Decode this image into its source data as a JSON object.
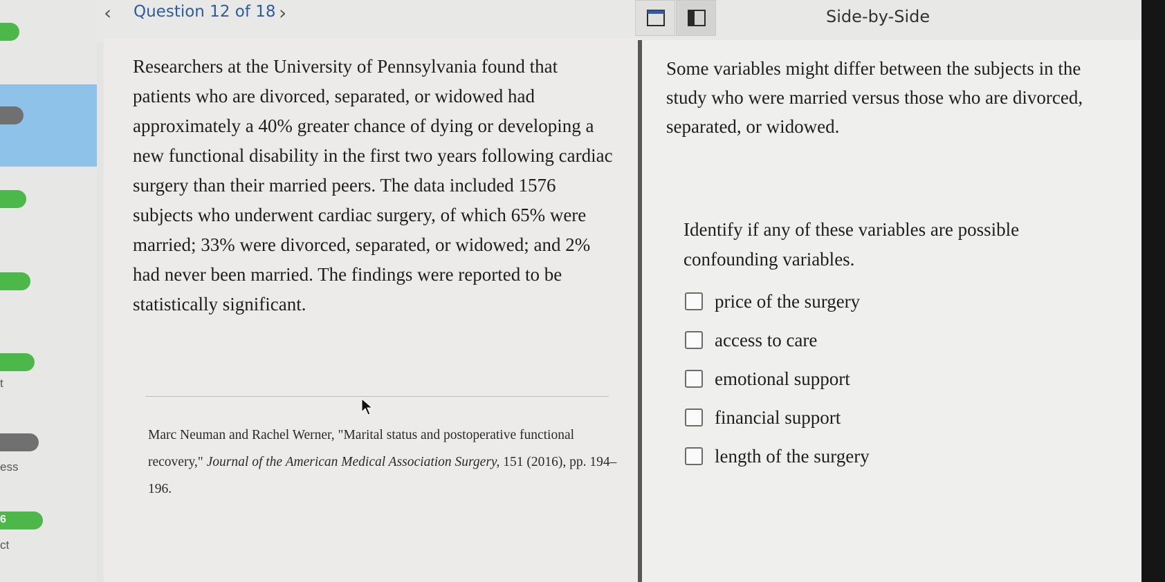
{
  "sidebar": {
    "labels": [
      "ess",
      "ct"
    ],
    "pct_label": "6",
    "edge_mark": "t"
  },
  "header": {
    "prev_icon": "chevron-left-icon",
    "next_icon": "chevron-right-icon",
    "question_counter": "Question 12 of 18",
    "layout_label": "Side-by-Side",
    "accent_color": "#2e5c9e"
  },
  "passage": {
    "text": "Researchers at the University of Pennsylvania found that patients who are divorced, separated, or widowed had approximately a 40% greater chance of dying or developing a new functional disability in the first two years following cardiac surgery than their married peers. The data included 1576 subjects who underwent cardiac surgery, of which 65% were married; 33% were divorced, separated, or widowed; and 2% had never been married. The findings were reported to be statistically significant.",
    "citation_authors": "Marc Neuman and Rachel Werner, \"Marital status and postoperative functional recovery,\"",
    "citation_journal": "Journal of the American Medical Association Surgery,",
    "citation_rest": "151 (2016), pp. 194–196."
  },
  "question": {
    "context": "Some variables might differ between the subjects in the study who were married versus those who are divorced, separated, or widowed.",
    "prompt": "Identify if any of these variables are possible confounding variables.",
    "options": [
      {
        "label": "price of the surgery",
        "checked": false
      },
      {
        "label": "access to care",
        "checked": false
      },
      {
        "label": "emotional support",
        "checked": false
      },
      {
        "label": "financial support",
        "checked": false
      },
      {
        "label": "length of the surgery",
        "checked": false
      }
    ]
  }
}
